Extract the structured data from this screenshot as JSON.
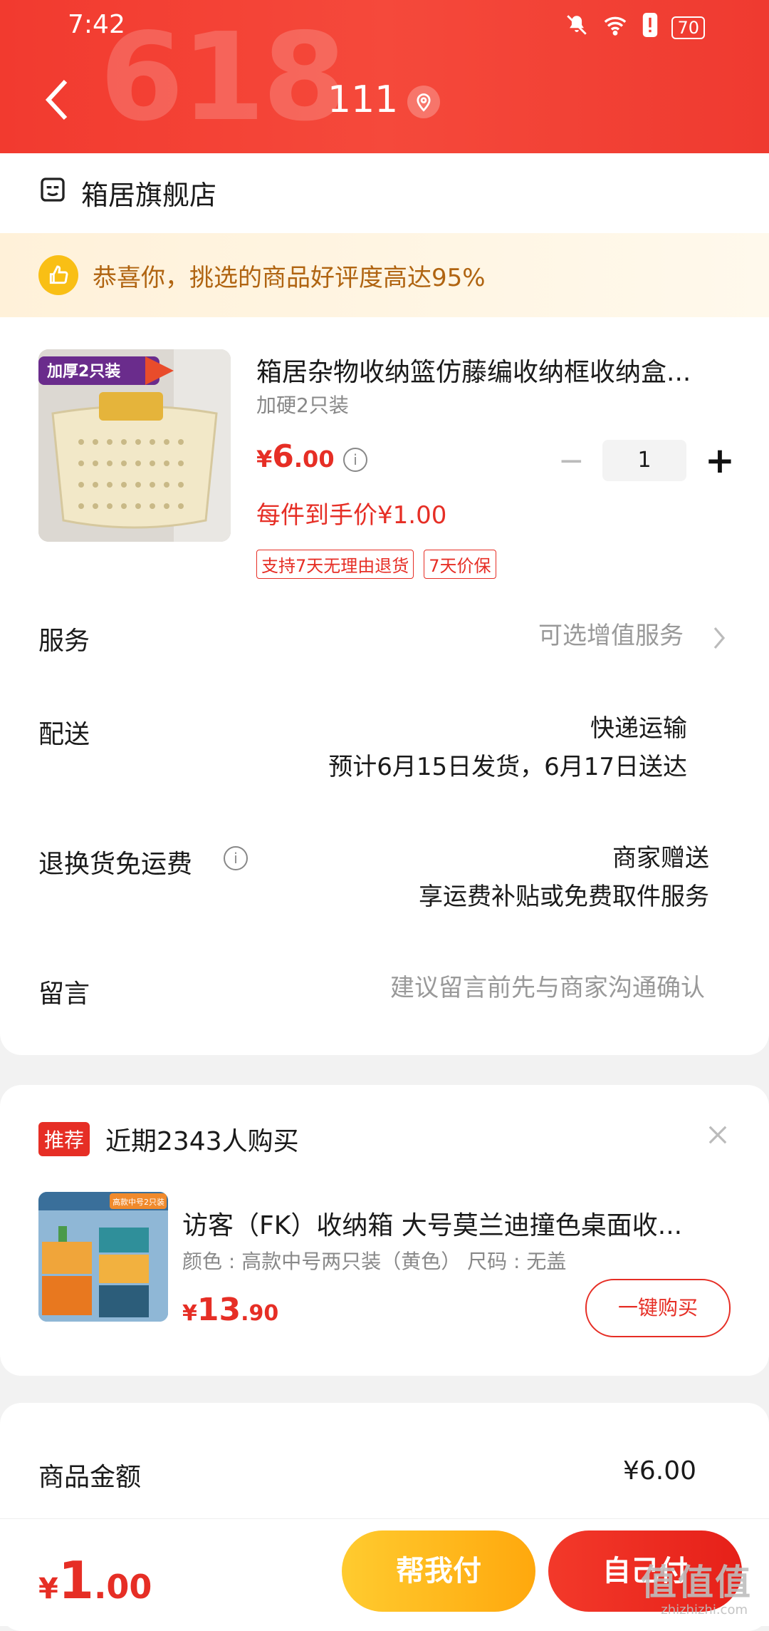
{
  "status": {
    "time": "7:42",
    "battery": "70"
  },
  "header": {
    "bg_text": "618",
    "title": "111"
  },
  "store": {
    "name": "箱居旗舰店"
  },
  "praise": {
    "text": "恭喜你，挑选的商品好评度高达95%"
  },
  "product": {
    "title": "箱居杂物收纳篮仿藤编收纳框收纳盒...",
    "spec": "加硬2只装",
    "image_badge": "加厚2只装",
    "price_symbol": "¥",
    "price_int": "6",
    "price_dec": ".00",
    "unit_price": "每件到手价¥1.00",
    "tags": [
      "支持7天无理由退货",
      "7天价保"
    ],
    "quantity": "1"
  },
  "rows": {
    "service_label": "服务",
    "service_value": "可选增值服务",
    "delivery_label": "配送",
    "delivery_method": "快递运输",
    "delivery_eta": "预计6月15日发货，6月17日送达",
    "return_label": "退换货免运费",
    "return_value1": "商家赠送",
    "return_value2": "享运费补贴或免费取件服务",
    "message_label": "留言",
    "message_placeholder": "建议留言前先与商家沟通确认"
  },
  "recommend": {
    "badge": "推荐",
    "title": "近期2343人购买",
    "item_name": "访客（FK）收纳箱 大号莫兰迪撞色桌面收...",
    "item_spec": "颜色 : 高款中号两只装（黄色）    尺码 : 无盖",
    "price_symbol": "¥",
    "price_int": "13",
    "price_dec": ".90",
    "buy_label": "一键购买",
    "image_badge": "高款中号2只装"
  },
  "summary": {
    "amount_label": "商品金额",
    "amount_value": "¥6.00"
  },
  "bottom": {
    "total_symbol": "¥",
    "total_int": "1",
    "total_dec": ".00",
    "pay_other_label": "帮我付",
    "pay_self_label": "自己付"
  },
  "watermark": {
    "main": "值值值",
    "sub": "zhizhizhi.com"
  },
  "colors": {
    "accent": "#e62e25",
    "header": "#f23a2f",
    "yellow": "#ffb81c"
  }
}
